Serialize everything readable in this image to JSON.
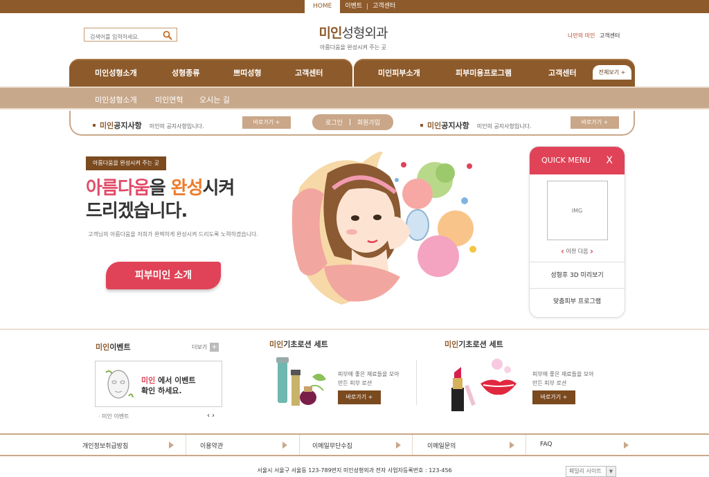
{
  "topnav": {
    "home": "HOME",
    "event": "이벤트",
    "support": "고객센터"
  },
  "header": {
    "search_placeholder": "검색어를 입력하세요.",
    "logo_bold": "미인",
    "logo_rest": "성형외과",
    "logo_sub": "아름다움을 완성시켜 주는 곳",
    "link_mine": "나만의 미인",
    "link_support": "고객센터"
  },
  "nav": {
    "left": [
      "미인성형소개",
      "성형종류",
      "쁘띠성형",
      "고객센터"
    ],
    "right": [
      "미인피부소개",
      "피부미용프로그램",
      "고객센터"
    ],
    "view_all": "전체보기 +"
  },
  "subnav": [
    "미인성형소개",
    "미인연혁",
    "오시는 길"
  ],
  "notice": {
    "title_bold": "미인",
    "title_rest": "공지사항",
    "text": "미인의 공지사항입니다.",
    "go": "바로가기 +",
    "login": "로그인",
    "join": "회원가입"
  },
  "hero": {
    "tag": "아름다움을 완성시켜 주는 곳",
    "h_pink": "아름다움",
    "h_mid": "을 ",
    "h_orange": "완성",
    "h_end": "시켜",
    "h_line2": "드리겠습니다.",
    "desc": "고객님의 아름다움을 저희가 완벽하게 완성시켜 드리도록 노력하겠습니다.",
    "cta": "피부미인 소개"
  },
  "quick": {
    "title": "QUICK MENU",
    "close": "X",
    "img": "IMG",
    "prev": "이전",
    "next": "다음",
    "item1": "성형후 3D 미리보기",
    "item2": "맞춤피부 프로그램"
  },
  "events": {
    "title_bold": "미인",
    "title_rest": "이벤트",
    "more": "더보기",
    "box_red": "미인",
    "box_l1": " 에서 이벤트",
    "box_l2": "확인 하세요.",
    "sub": "· 미인 이벤트"
  },
  "products": [
    {
      "title_bold": "미인",
      "title_rest": "기초로션 세트",
      "l1": "피부에 좋은 재료들을 모아",
      "l2": "만든 피부 로션",
      "btn": "바로가기 +"
    },
    {
      "title_bold": "미인",
      "title_rest": "기초로션 세트",
      "l1": "피부에 좋은 재료들을 모아",
      "l2": "만든 피부 로션",
      "btn": "바로가기 +"
    }
  ],
  "footer": {
    "links": [
      "개인정보취급방침",
      "이용약관",
      "이메일무단수집",
      "이메일문의",
      "FAQ"
    ],
    "address": "서울시 서울구 서울동 123-789번지 미인성형외과 전자 사업자등록번호 : 123-456",
    "family": "패밀리 사이트"
  },
  "colors": {
    "brown": "#8d5a2b",
    "tan": "#c9a788",
    "pink": "#e04357",
    "orange": "#ee7b2a"
  }
}
